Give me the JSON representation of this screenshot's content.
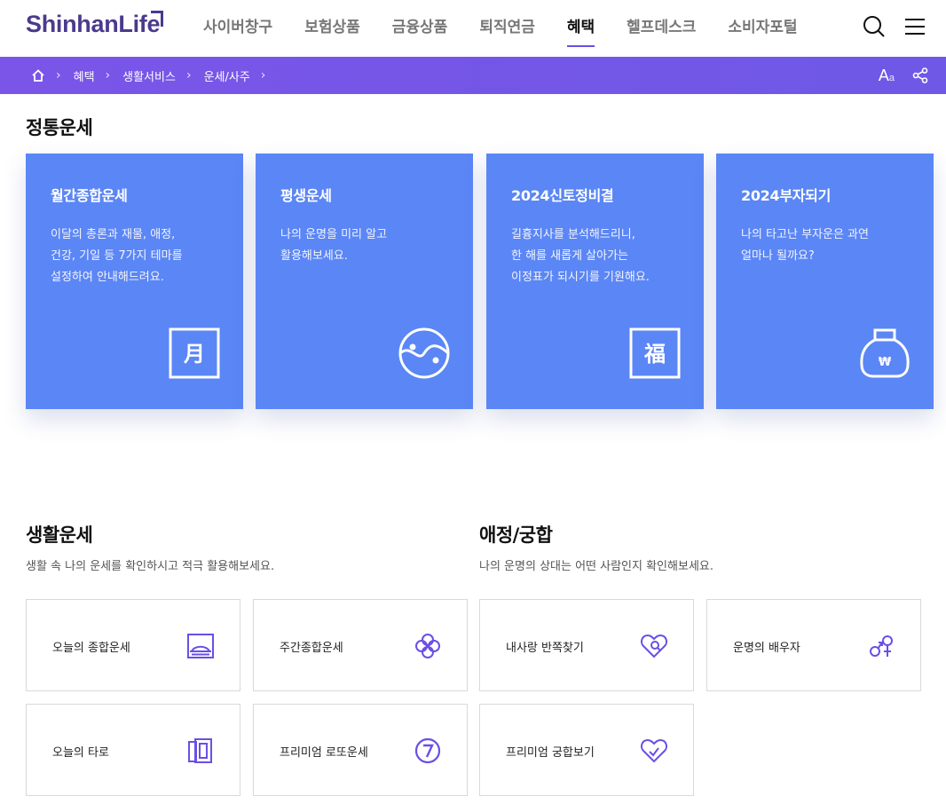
{
  "header": {
    "logo": "ShinhanLife",
    "nav": [
      "사이버창구",
      "보험상품",
      "금융상품",
      "퇴직연금",
      "혜택",
      "헬프데스크",
      "소비자포털"
    ],
    "active_nav": "혜택"
  },
  "breadcrumb": {
    "items": [
      "혜택",
      "생활서비스",
      "운세/사주"
    ]
  },
  "toolbar": {
    "font_size_label": "A",
    "font_size_small": "a"
  },
  "traditional": {
    "title": "정통운세",
    "cards": [
      {
        "title": "월간종합운세",
        "desc": "이달의 총론과 재물, 애정,\n건강, 기일 등 7가지 테마를\n설정하여 안내해드려요.",
        "icon": "moon-char-icon",
        "glyph": "月"
      },
      {
        "title": "평생운세",
        "desc": "나의 운명을 미리 알고\n활용해보세요.",
        "icon": "yin-yang-face-icon"
      },
      {
        "title": "2024신토정비결",
        "desc": "길흉지사를 분석해드리니,\n한 해를 새롭게 살아가는\n이정표가 되시기를 기원해요.",
        "icon": "blessing-char-icon",
        "glyph": "福"
      },
      {
        "title": "2024부자되기",
        "desc": "나의 타고난 부자운은 과연\n얼마나 될까요?",
        "icon": "money-bag-icon"
      }
    ]
  },
  "life": {
    "title": "생활운세",
    "desc": "생활 속 나의 운세를 확인하시고 적극 활용해보세요.",
    "items": [
      {
        "label": "오늘의 종합운세",
        "icon": "sunrise-icon"
      },
      {
        "label": "주간종합운세",
        "icon": "clover-icon"
      },
      {
        "label": "오늘의 타로",
        "icon": "tarot-cards-icon"
      },
      {
        "label": "프리미엄 로또운세",
        "icon": "lucky-seven-icon"
      }
    ]
  },
  "love": {
    "title": "애정/궁합",
    "desc": "나의 운명의 상대는 어떤 사람인지 확인해보세요.",
    "items": [
      {
        "label": "내사랑 반쪽찾기",
        "icon": "heart-search-icon"
      },
      {
        "label": "운명의 배우자",
        "icon": "gender-symbols-icon"
      },
      {
        "label": "프리미엄 궁합보기",
        "icon": "heart-check-icon"
      }
    ]
  },
  "colors": {
    "brand": "#4b3a8c",
    "accent": "#6f58e6",
    "card": "#5b86f5",
    "icon": "#6a4fe6"
  }
}
